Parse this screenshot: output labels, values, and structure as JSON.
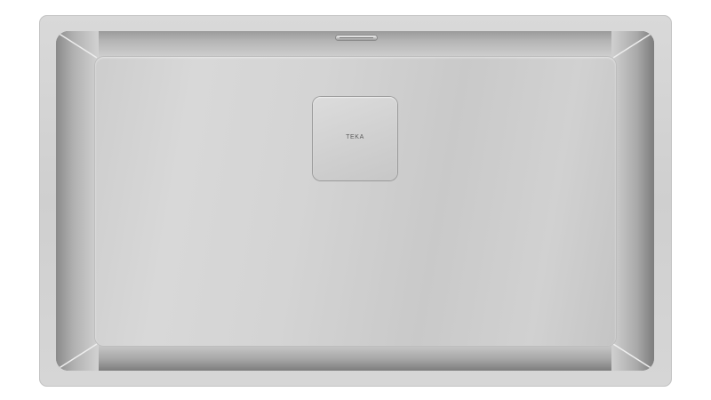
{
  "product": {
    "brand_mark": "TEKA"
  },
  "colors": {
    "steel_light": "#d8d8d8",
    "steel_mid": "#c9c9c9",
    "steel_dark": "#8e8e8e",
    "background": "#ffffff"
  }
}
